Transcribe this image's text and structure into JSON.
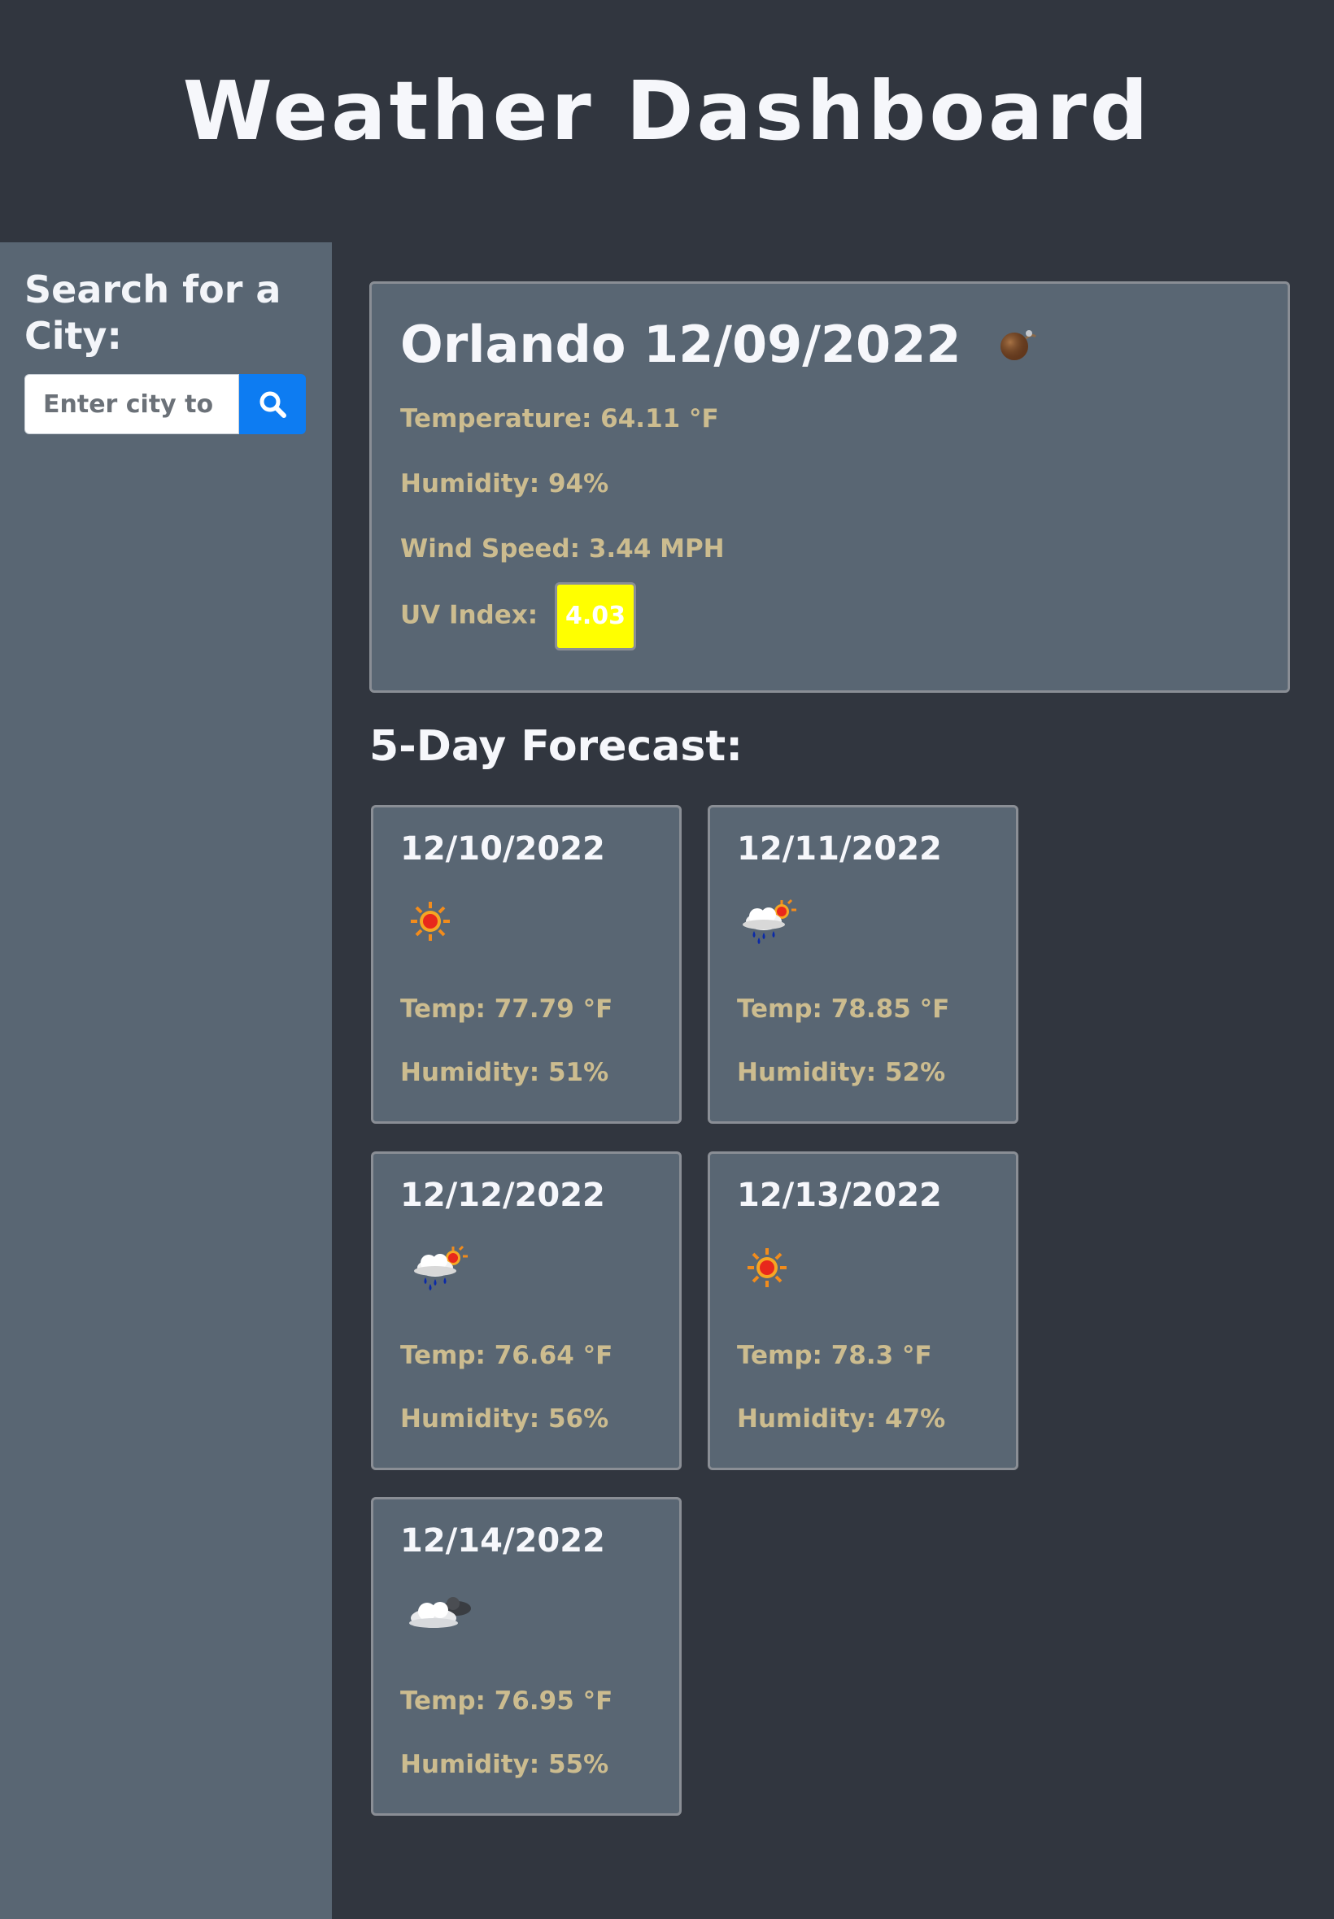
{
  "header": {
    "title": "Weather Dashboard"
  },
  "sidebar": {
    "title": "Search for a City:",
    "search_placeholder": "Enter city to view",
    "search_icon": "search-icon"
  },
  "current": {
    "city_date": "Orlando 12/09/2022",
    "icon": "mist-icon",
    "temperature": "Temperature: 64.11 °F",
    "humidity": "Humidity: 94%",
    "wind": "Wind Speed: 3.44 MPH",
    "uv_label": "UV Index:",
    "uv_value": "4.03",
    "uv_color": "#ffff00"
  },
  "forecast": {
    "title": "5-Day Forecast:",
    "days": [
      {
        "date": "12/10/2022",
        "icon": "sun-icon",
        "temp": "Temp: 77.79 °F",
        "humidity": "Humidity: 51%"
      },
      {
        "date": "12/11/2022",
        "icon": "rain-sun-icon",
        "temp": "Temp: 78.85 °F",
        "humidity": "Humidity: 52%"
      },
      {
        "date": "12/12/2022",
        "icon": "rain-sun-icon",
        "temp": "Temp: 76.64 °F",
        "humidity": "Humidity: 56%"
      },
      {
        "date": "12/13/2022",
        "icon": "sun-icon",
        "temp": "Temp: 78.3 °F",
        "humidity": "Humidity: 47%"
      },
      {
        "date": "12/14/2022",
        "icon": "cloud-icon",
        "temp": "Temp: 76.95 °F",
        "humidity": "Humidity: 55%"
      }
    ]
  },
  "colors": {
    "background": "#31363f",
    "panel": "#596673",
    "accent_text": "#ccbc8f",
    "button": "#0d7cf2"
  }
}
